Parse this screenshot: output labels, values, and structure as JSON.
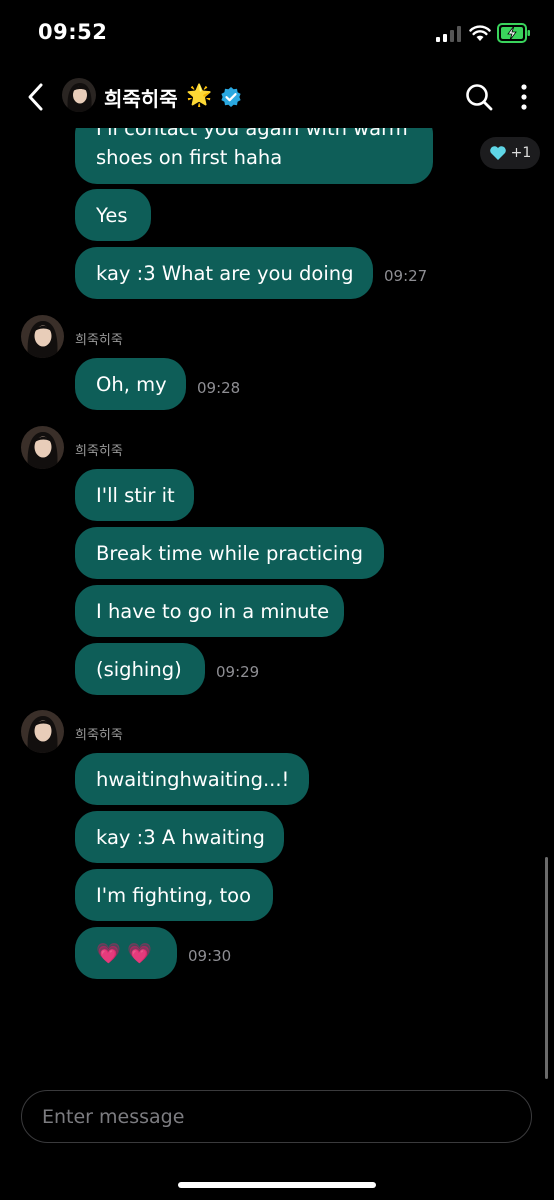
{
  "status_bar": {
    "time": "09:52"
  },
  "header": {
    "name": "희죽히죽",
    "star": "🌟"
  },
  "reaction_badge": {
    "count": "+1"
  },
  "messages": [
    {
      "text_line1": "I'll contact you again with warm",
      "text_line2": "shoes on first haha"
    },
    {
      "text": "Yes"
    },
    {
      "text": "kay :3 What are you doing",
      "time": "09:27"
    },
    {
      "sender": "희죽히죽"
    },
    {
      "text": "Oh, my",
      "time": "09:28"
    },
    {
      "sender": "희죽히죽"
    },
    {
      "text": "I'll stir it"
    },
    {
      "text": "Break time while practicing"
    },
    {
      "text": "I have to go in a minute"
    },
    {
      "text": "(sighing)",
      "time": "09:29"
    },
    {
      "sender": "희죽히죽"
    },
    {
      "text": "hwaitinghwaiting...!"
    },
    {
      "text": "kay :3 A hwaiting"
    },
    {
      "text": "I'm fighting, too"
    },
    {
      "text": "💗 💗",
      "time": "09:30"
    }
  ],
  "composer": {
    "placeholder": "Enter message"
  },
  "colors": {
    "bubble": "#0e5e58",
    "verified": "#2aa8e0",
    "background": "#000000"
  }
}
